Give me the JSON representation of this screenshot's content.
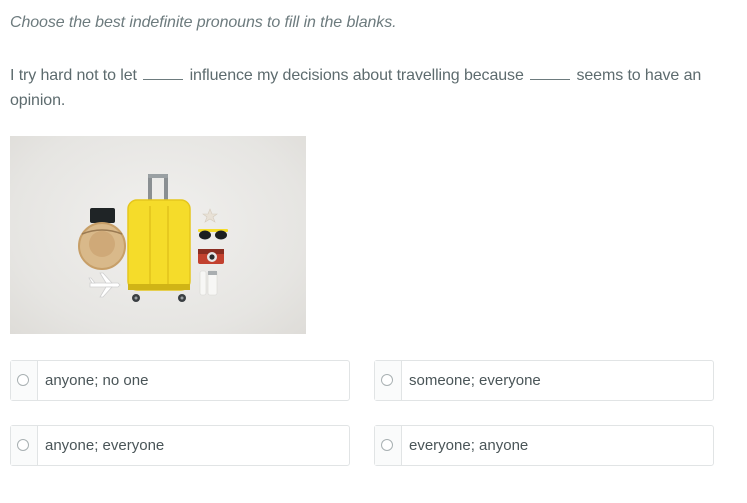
{
  "instruction": "Choose the best indefinite pronouns to fill in the blanks.",
  "question": {
    "part1": "I try hard not to let",
    "part2": "influence my decisions about travelling because",
    "part3": "seems to have an opinion."
  },
  "image": {
    "description_icon": "travel-flatlay-image",
    "colors": {
      "background": "#eceae7",
      "suitcase": "#f5dc2a",
      "hat": "#d9b98a"
    }
  },
  "options": [
    {
      "label": "anyone; no one"
    },
    {
      "label": "someone; everyone"
    },
    {
      "label": "anyone; everyone"
    },
    {
      "label": "everyone; anyone"
    }
  ]
}
